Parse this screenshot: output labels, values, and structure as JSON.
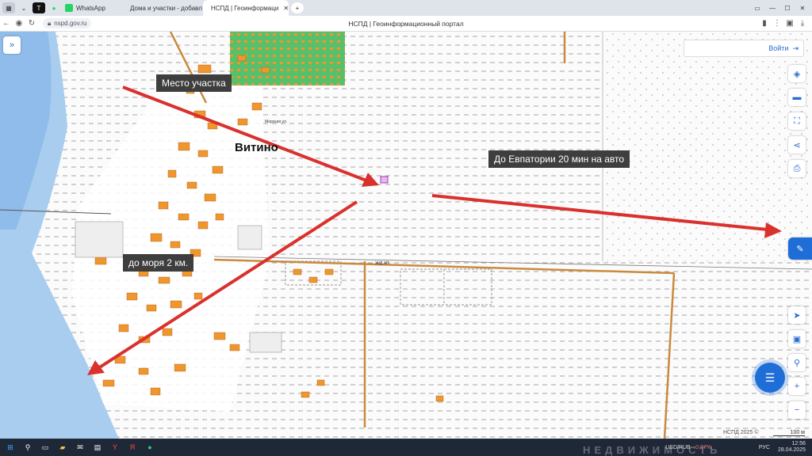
{
  "browser": {
    "tabs": [
      {
        "label": "WhatsApp",
        "color": "#25d366"
      },
      {
        "label": "Дома и участки - добавл",
        "color": "#111111"
      },
      {
        "label": "НСПД | Геоинформаци",
        "color": "#1a6fd6"
      }
    ],
    "url": "nspd.gov.ru",
    "page_title": "НСПД | Геоинформационный портал"
  },
  "map": {
    "village_name": "Витино",
    "annotations": {
      "plot_location": "Место участка",
      "to_evpatoria": "До Евпатории 20 мин на авто",
      "to_sea": "до моря 2 км."
    },
    "login_label": "Войти",
    "attribution": "НСПД 2025 ©",
    "scale_label": "100 м",
    "road_label": "Ж/Д АП",
    "street_label": "Морская ул."
  },
  "taskbar": {
    "currency_pair": "USD/RUB",
    "currency_change": "-0,27%",
    "lang": "РУС",
    "time": "12:56",
    "date": "28.04.2025",
    "watermark": "НЕДВИЖИМОСТЬ"
  },
  "colors": {
    "arrow": "#d9312d",
    "building": "#f0962e",
    "green": "#58c06a",
    "sea": "#a9cdef",
    "accent": "#2a6ad0"
  }
}
